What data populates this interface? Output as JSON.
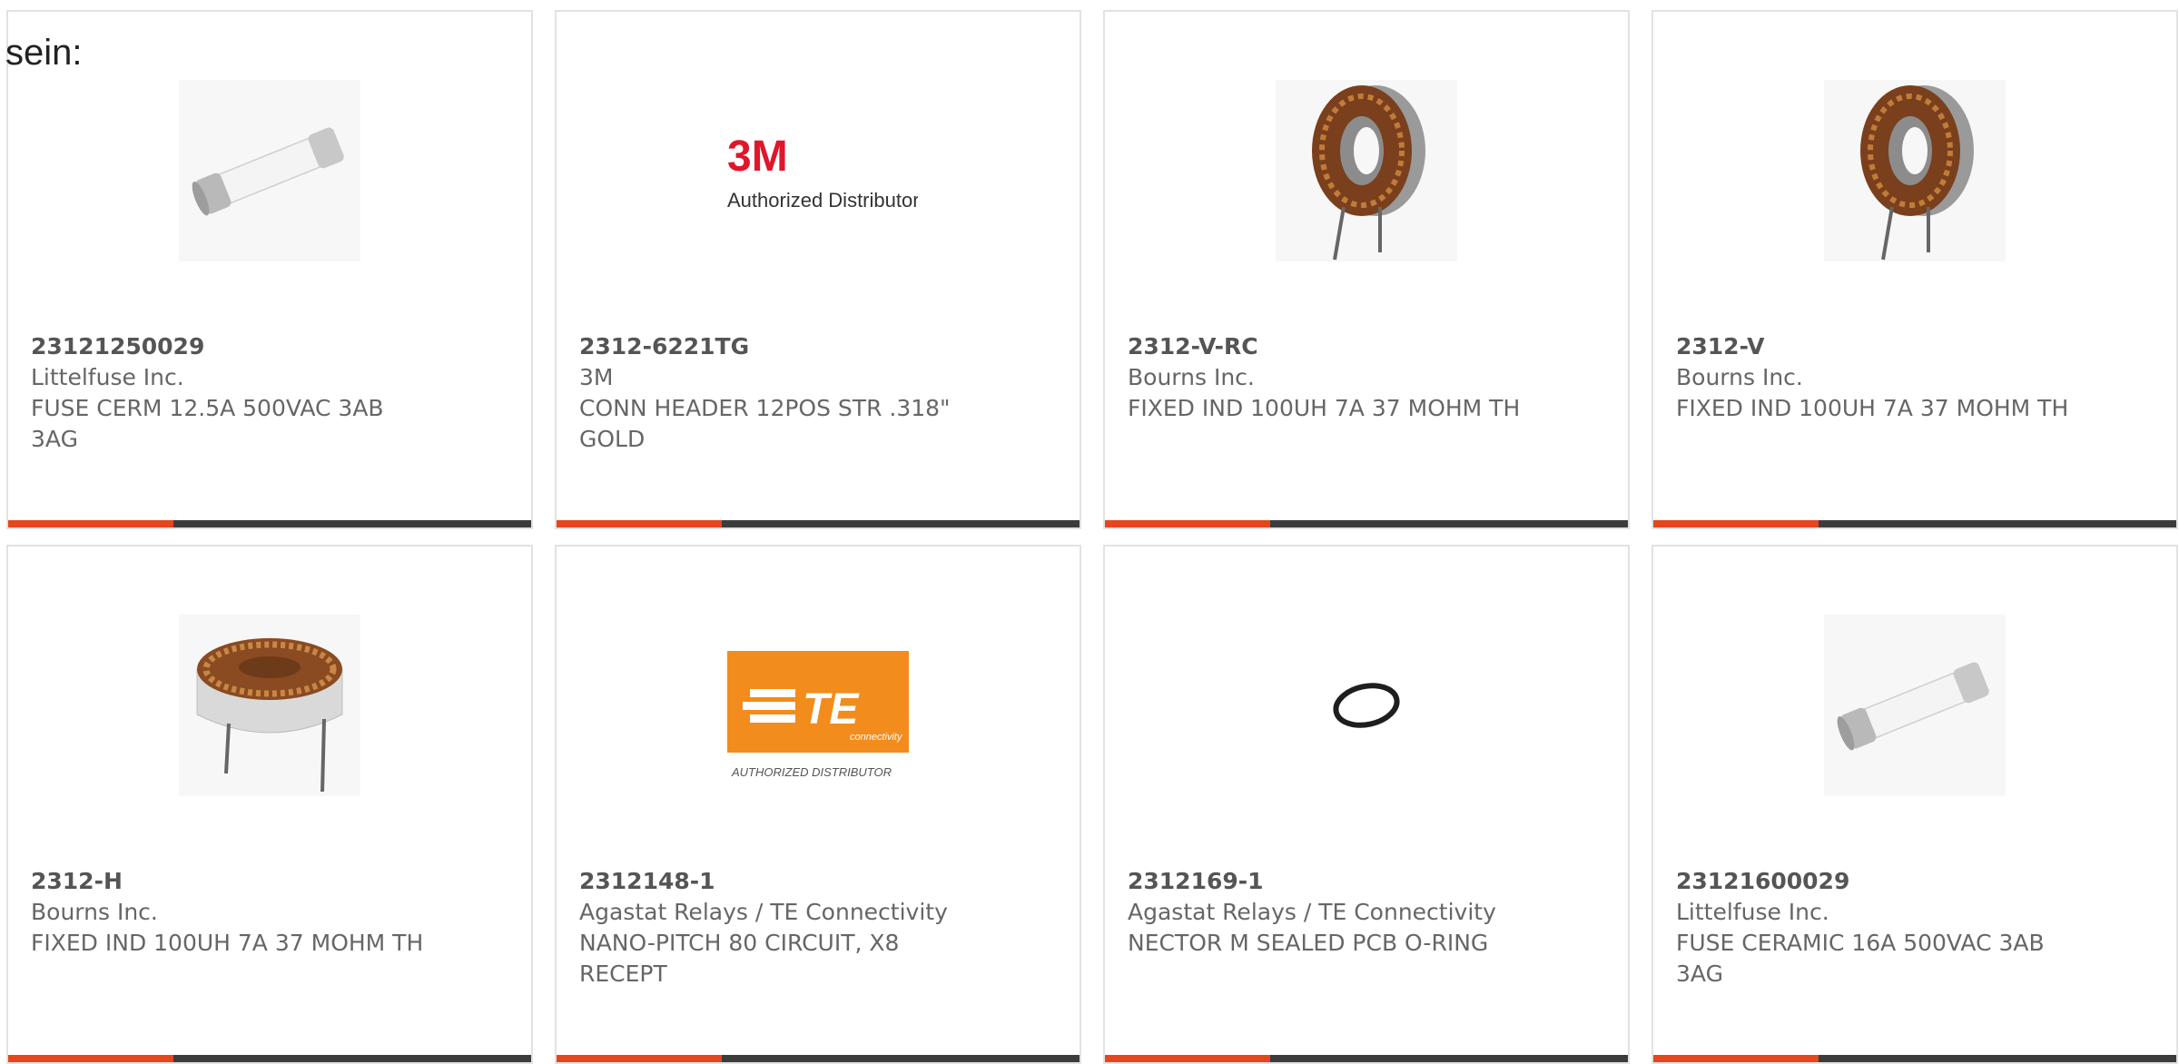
{
  "intro_text": "sein:",
  "accent_color": "#e6461e",
  "bar_color": "#3c3c3c",
  "products": [
    {
      "part": "23121250029",
      "manufacturer": "Littelfuse Inc.",
      "description": "FUSE CERM 12.5A 500VAC 3AB 3AG",
      "image": "fuse-image"
    },
    {
      "part": "2312-6221TG",
      "manufacturer": "3M",
      "description": "CONN HEADER 12POS STR .318\" GOLD",
      "image": "3m-logo",
      "logo_text": "3M",
      "logo_caption": "Authorized Distributor"
    },
    {
      "part": "2312-V-RC",
      "manufacturer": "Bourns Inc.",
      "description": "FIXED IND 100UH 7A 37 MOHM TH",
      "image": "toroid-inductor-vertical-image"
    },
    {
      "part": "2312-V",
      "manufacturer": "Bourns Inc.",
      "description": "FIXED IND 100UH 7A 37 MOHM TH",
      "image": "toroid-inductor-vertical-image"
    },
    {
      "part": "2312-H",
      "manufacturer": "Bourns Inc.",
      "description": "FIXED IND 100UH 7A 37 MOHM TH",
      "image": "toroid-inductor-horizontal-image"
    },
    {
      "part": "2312148-1",
      "manufacturer": "Agastat Relays / TE Connectivity",
      "description": "NANO-PITCH 80 CIRCUIT, X8 RECEPT",
      "image": "te-logo",
      "logo_text": "TE",
      "logo_subtext": "connectivity",
      "logo_caption": "AUTHORIZED DISTRIBUTOR"
    },
    {
      "part": "2312169-1",
      "manufacturer": "Agastat Relays / TE Connectivity",
      "description": "NECTOR M SEALED PCB O-RING",
      "image": "o-ring-image"
    },
    {
      "part": "23121600029",
      "manufacturer": "Littelfuse Inc.",
      "description": "FUSE CERAMIC 16A 500VAC 3AB 3AG",
      "image": "fuse-image"
    }
  ]
}
